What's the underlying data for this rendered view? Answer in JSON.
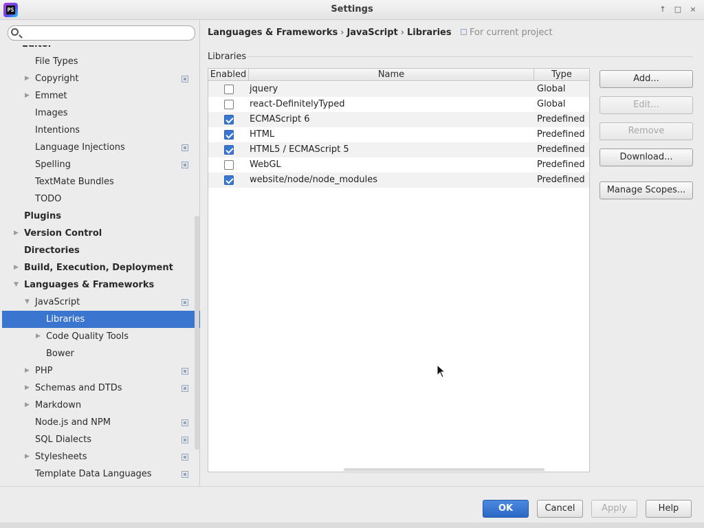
{
  "window": {
    "title": "Settings",
    "app_icon_text": "PS",
    "controls": [
      "↑",
      "□",
      "×"
    ]
  },
  "sidebar": {
    "search_placeholder": "",
    "items": [
      {
        "label": "Editor",
        "level": 0,
        "bold": true,
        "expandable": false,
        "project": false
      },
      {
        "label": "File Types",
        "level": 1,
        "bold": false,
        "expandable": false,
        "project": false
      },
      {
        "label": "Copyright",
        "level": 1,
        "bold": false,
        "expandable": true,
        "expanded": false,
        "project": true
      },
      {
        "label": "Emmet",
        "level": 1,
        "bold": false,
        "expandable": true,
        "expanded": false,
        "project": false
      },
      {
        "label": "Images",
        "level": 1,
        "bold": false,
        "expandable": false,
        "project": false
      },
      {
        "label": "Intentions",
        "level": 1,
        "bold": false,
        "expandable": false,
        "project": false
      },
      {
        "label": "Language Injections",
        "level": 1,
        "bold": false,
        "expandable": false,
        "project": true
      },
      {
        "label": "Spelling",
        "level": 1,
        "bold": false,
        "expandable": false,
        "project": true
      },
      {
        "label": "TextMate Bundles",
        "level": 1,
        "bold": false,
        "expandable": false,
        "project": false
      },
      {
        "label": "TODO",
        "level": 1,
        "bold": false,
        "expandable": false,
        "project": false
      },
      {
        "label": "Plugins",
        "level": 0,
        "bold": true,
        "expandable": false,
        "project": false
      },
      {
        "label": "Version Control",
        "level": 0,
        "bold": true,
        "expandable": true,
        "expanded": false,
        "project": false
      },
      {
        "label": "Directories",
        "level": 0,
        "bold": true,
        "expandable": false,
        "project": false
      },
      {
        "label": "Build, Execution, Deployment",
        "level": 0,
        "bold": true,
        "expandable": true,
        "expanded": false,
        "project": false
      },
      {
        "label": "Languages & Frameworks",
        "level": 0,
        "bold": true,
        "expandable": true,
        "expanded": true,
        "project": false
      },
      {
        "label": "JavaScript",
        "level": 1,
        "bold": false,
        "expandable": true,
        "expanded": true,
        "project": true
      },
      {
        "label": "Libraries",
        "level": 2,
        "bold": false,
        "expandable": false,
        "project": false,
        "selected": true
      },
      {
        "label": "Code Quality Tools",
        "level": 2,
        "bold": false,
        "expandable": true,
        "expanded": false,
        "project": false
      },
      {
        "label": "Bower",
        "level": 2,
        "bold": false,
        "expandable": false,
        "project": false
      },
      {
        "label": "PHP",
        "level": 1,
        "bold": false,
        "expandable": true,
        "expanded": false,
        "project": true
      },
      {
        "label": "Schemas and DTDs",
        "level": 1,
        "bold": false,
        "expandable": true,
        "expanded": false,
        "project": true
      },
      {
        "label": "Markdown",
        "level": 1,
        "bold": false,
        "expandable": true,
        "expanded": false,
        "project": false
      },
      {
        "label": "Node.js and NPM",
        "level": 1,
        "bold": false,
        "expandable": false,
        "project": true
      },
      {
        "label": "SQL Dialects",
        "level": 1,
        "bold": false,
        "expandable": false,
        "project": true
      },
      {
        "label": "Stylesheets",
        "level": 1,
        "bold": false,
        "expandable": true,
        "expanded": false,
        "project": true
      },
      {
        "label": "Template Data Languages",
        "level": 1,
        "bold": false,
        "expandable": false,
        "project": true
      }
    ]
  },
  "breadcrumb": {
    "parts": [
      "Languages & Frameworks",
      "JavaScript",
      "Libraries"
    ],
    "separator": "›",
    "scope_label": "For current project"
  },
  "libraries": {
    "section_title": "Libraries",
    "columns": {
      "enabled": "Enabled",
      "name": "Name",
      "type": "Type"
    },
    "rows": [
      {
        "enabled": false,
        "name": "jquery",
        "type": "Global"
      },
      {
        "enabled": false,
        "name": "react-DefinitelyTyped",
        "type": "Global"
      },
      {
        "enabled": true,
        "name": "ECMAScript 6",
        "type": "Predefined"
      },
      {
        "enabled": true,
        "name": "HTML",
        "type": "Predefined"
      },
      {
        "enabled": true,
        "name": "HTML5 / ECMAScript 5",
        "type": "Predefined"
      },
      {
        "enabled": false,
        "name": "WebGL",
        "type": "Predefined"
      },
      {
        "enabled": true,
        "name": "website/node/node_modules",
        "type": "Predefined"
      }
    ]
  },
  "side_buttons": {
    "add": "Add...",
    "edit": "Edit...",
    "remove": "Remove",
    "download": "Download...",
    "manage_scopes": "Manage Scopes..."
  },
  "footer": {
    "ok": "OK",
    "cancel": "Cancel",
    "apply": "Apply",
    "help": "Help"
  },
  "colors": {
    "accent": "#3a76d0",
    "selection_text": "#ffffff"
  }
}
